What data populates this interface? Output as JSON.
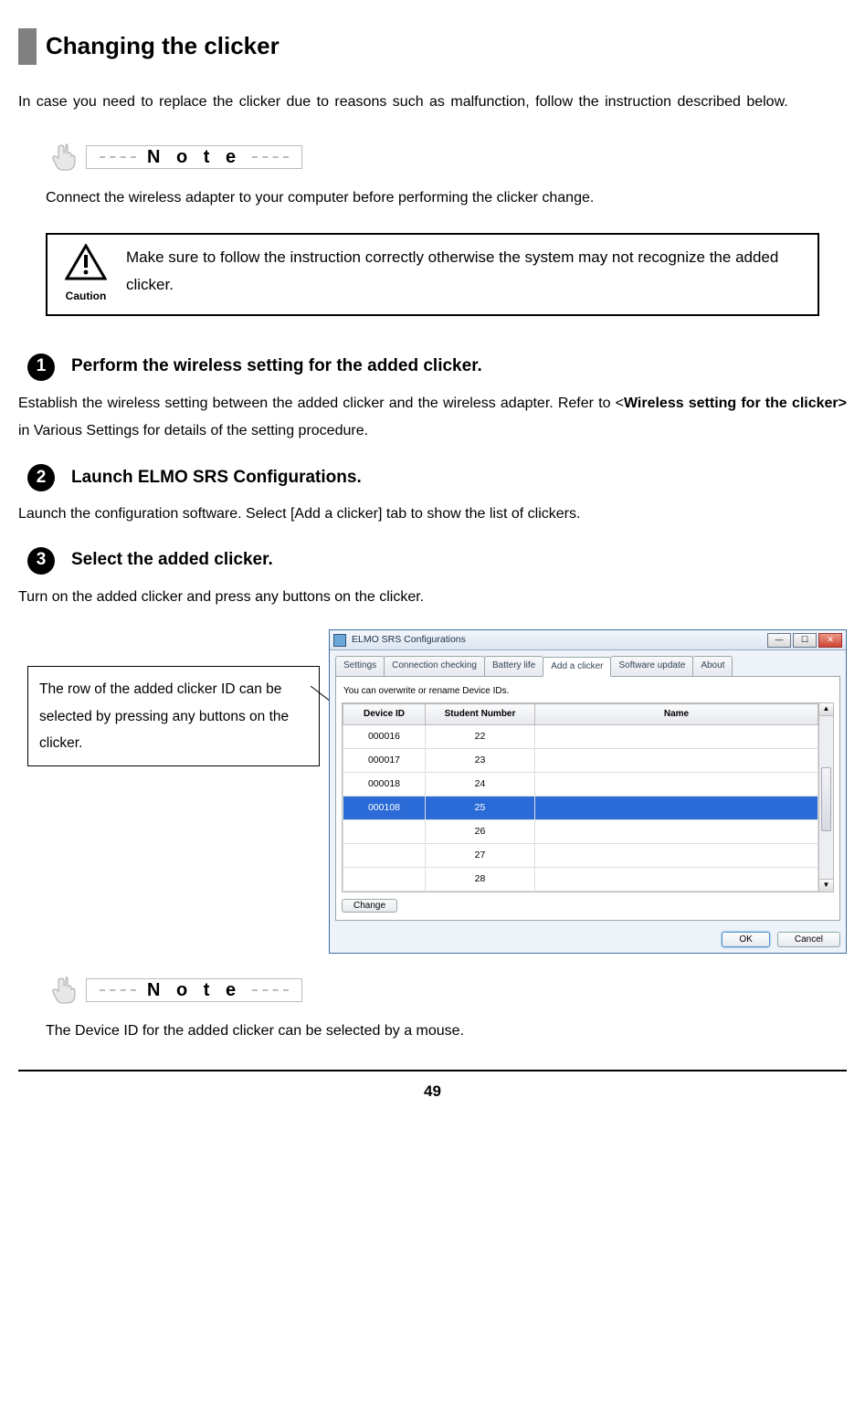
{
  "heading": "Changing the clicker",
  "intro": "In case you need to replace the clicker due to reasons such as malfunction, follow the instruction described below.",
  "note_word": "N o t e",
  "note1_text": "Connect the wireless adapter to your computer before performing the clicker change.",
  "caution_label": "Caution",
  "caution_text": "Make sure to follow the instruction correctly otherwise the system may not recognize the added clicker.",
  "steps": [
    {
      "num": "1",
      "title": "Perform the wireless setting for the added clicker.",
      "body_pre": "Establish the wireless setting between the added clicker and the wireless adapter.\nRefer to <",
      "body_link": "Wireless setting for the clicker>",
      "body_post": " in Various Settings for details of the setting procedure."
    },
    {
      "num": "2",
      "title": "Launch ELMO SRS Configurations.",
      "body": "Launch the configuration software. Select [Add a clicker] tab to show the list of clickers."
    },
    {
      "num": "3",
      "title": "Select the added clicker.",
      "body": "Turn on the added clicker and press any buttons on the clicker."
    }
  ],
  "callout": "The row of the added clicker ID can be selected by pressing any buttons on the clicker.",
  "app": {
    "title": "ELMO SRS Configurations",
    "tabs": [
      "Settings",
      "Connection checking",
      "Battery life",
      "Add a clicker",
      "Software update",
      "About"
    ],
    "active_tab": 3,
    "instruction": "You can overwrite or rename Device IDs.",
    "columns": [
      "Device ID",
      "Student Number",
      "Name"
    ],
    "rows": [
      {
        "id": "000016",
        "sn": "22",
        "name": "",
        "selected": false
      },
      {
        "id": "000017",
        "sn": "23",
        "name": "",
        "selected": false
      },
      {
        "id": "000018",
        "sn": "24",
        "name": "",
        "selected": false
      },
      {
        "id": "000108",
        "sn": "25",
        "name": "",
        "selected": true
      },
      {
        "id": "",
        "sn": "26",
        "name": "",
        "selected": false
      },
      {
        "id": "",
        "sn": "27",
        "name": "",
        "selected": false
      },
      {
        "id": "",
        "sn": "28",
        "name": "",
        "selected": false
      }
    ],
    "change_btn": "Change",
    "ok_btn": "OK",
    "cancel_btn": "Cancel"
  },
  "note2_text": "The Device ID for the added clicker can be selected by a mouse.",
  "page_number": "49"
}
